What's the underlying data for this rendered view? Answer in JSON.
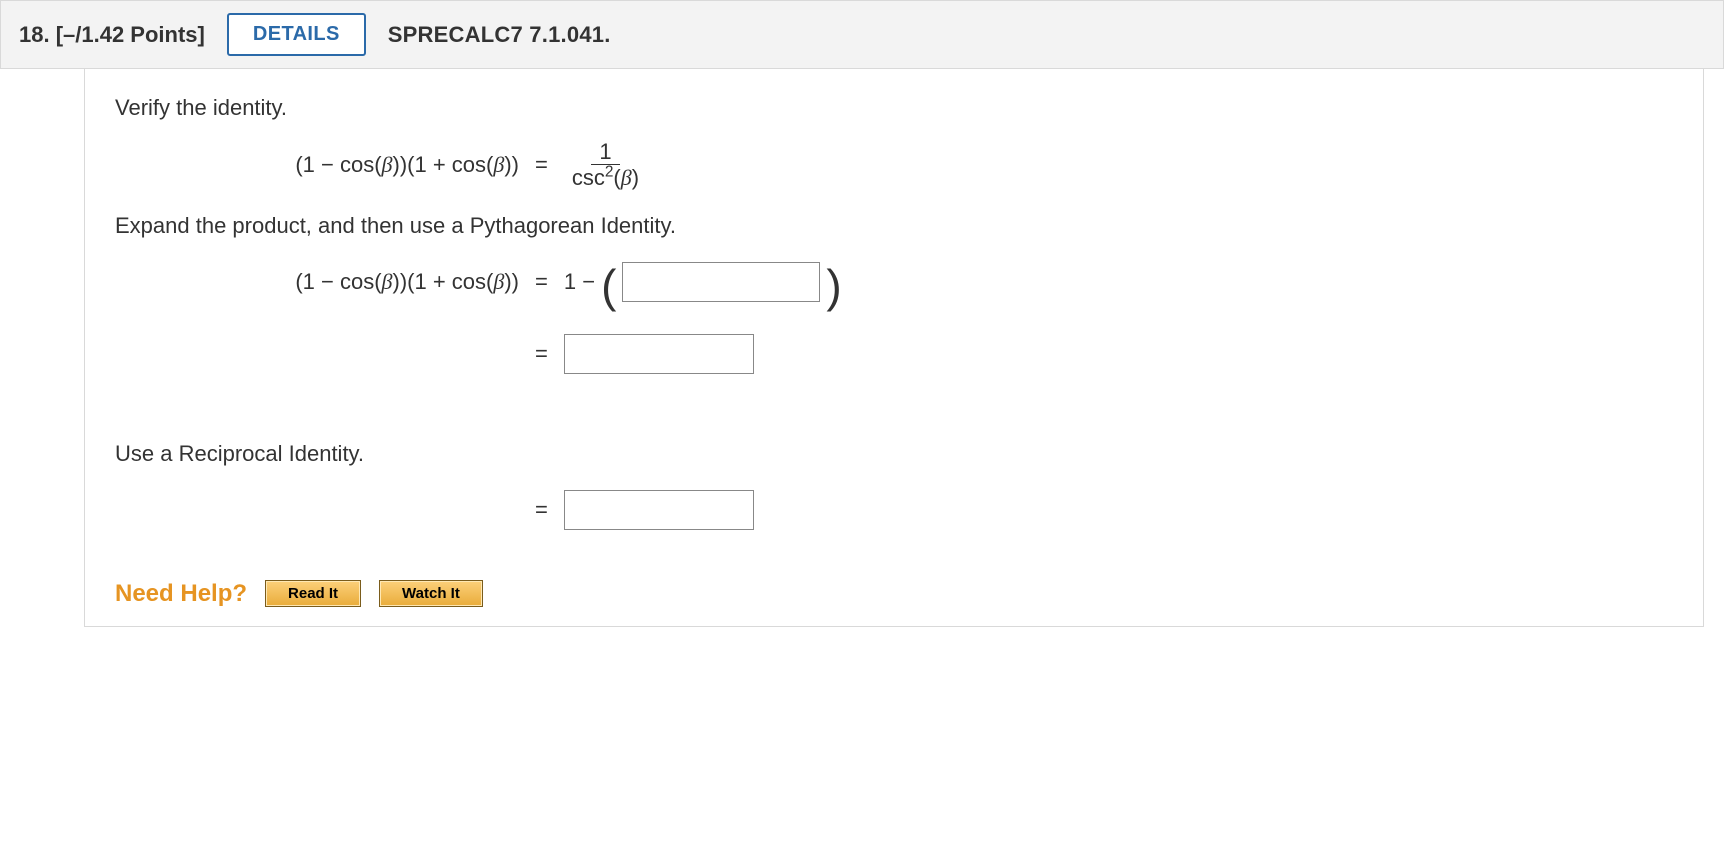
{
  "header": {
    "number_label": "18. [–/1.42 Points]",
    "details_label": "DETAILS",
    "reference": "SPRECALC7 7.1.041."
  },
  "body": {
    "verify_label": "Verify the identity.",
    "identity_lhs": "(1 − cos(β))(1 + cos(β))",
    "identity_frac_num": "1",
    "identity_frac_den_pre": "csc",
    "identity_frac_den_exp": "2",
    "identity_frac_den_arg": "(β)",
    "expand_label": "Expand the product, and then use a Pythagorean Identity.",
    "step1_lhs": "(1 − cos(β))(1 + cos(β))",
    "step1_rhs_prefix": "1 −",
    "reciprocal_label": "Use a Reciprocal Identity."
  },
  "help": {
    "need_help_label": "Need Help?",
    "read_it_label": "Read It",
    "watch_it_label": "Watch It"
  }
}
